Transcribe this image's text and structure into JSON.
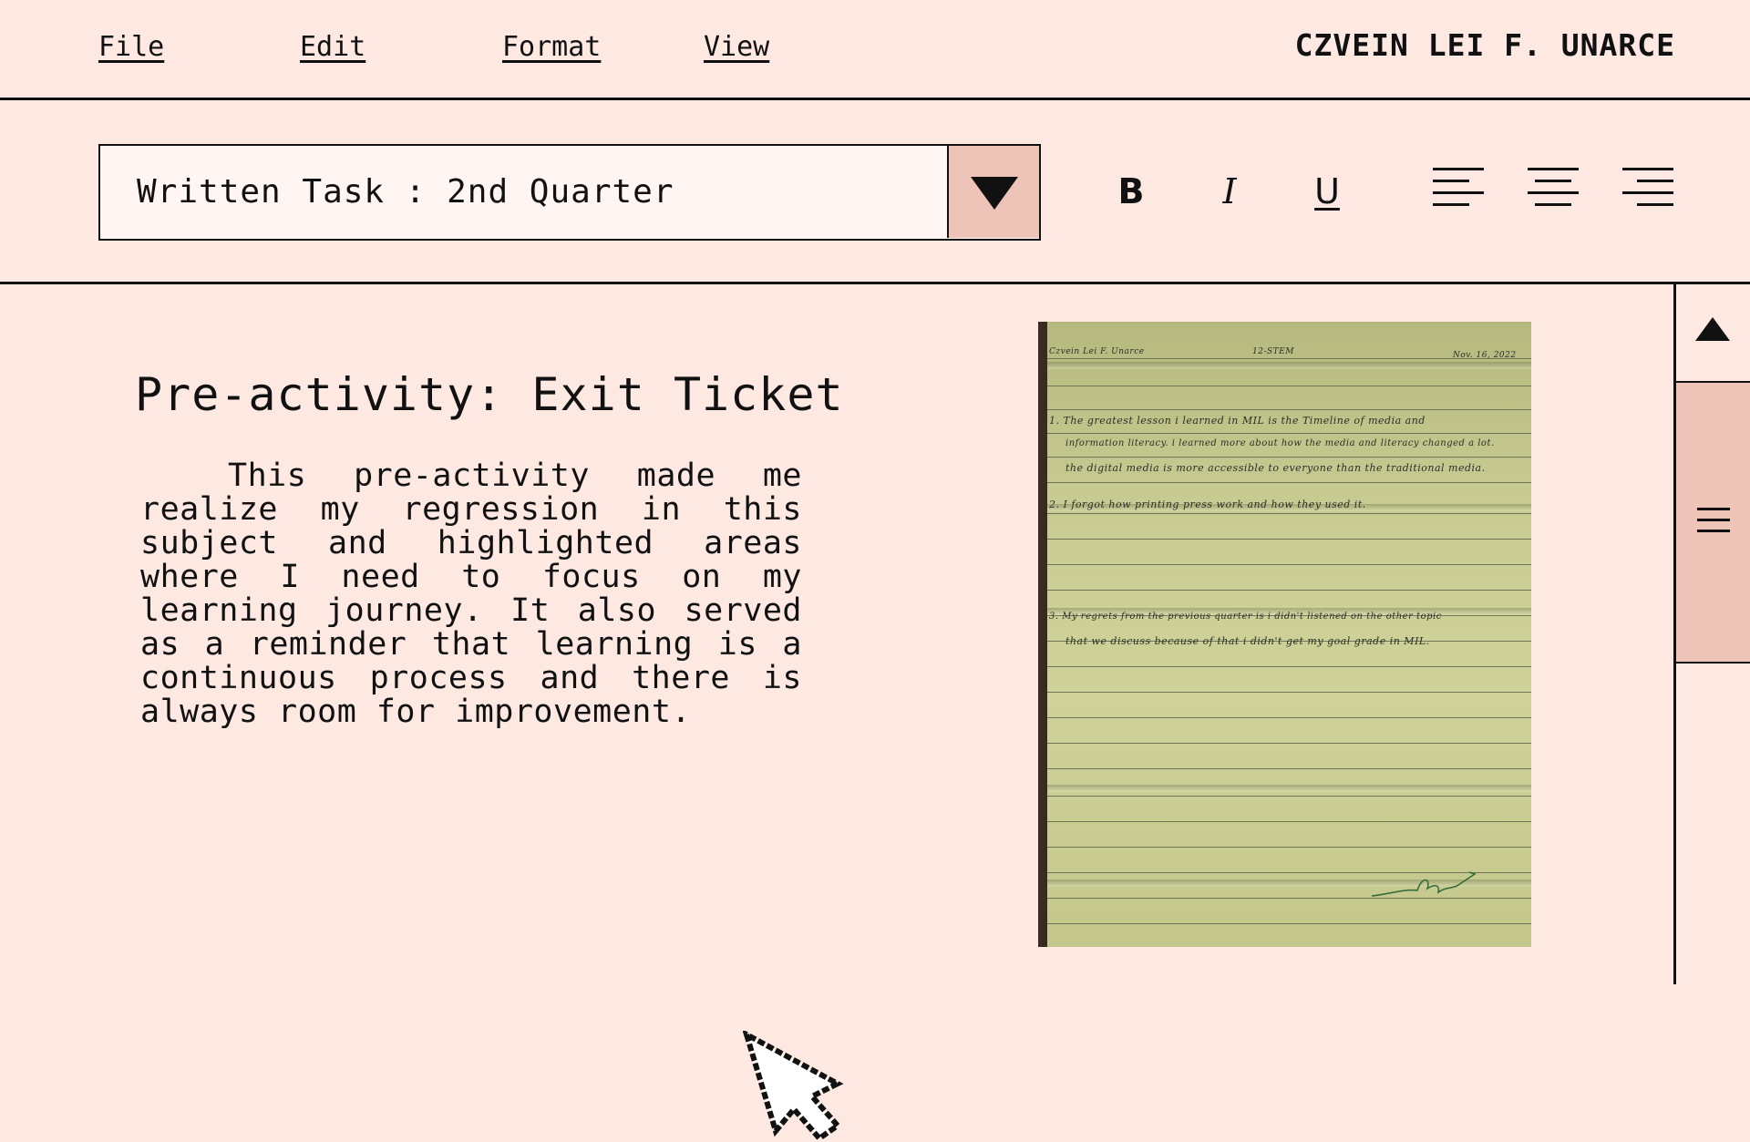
{
  "menu": {
    "file": "File",
    "edit": "Edit",
    "format": "Format",
    "view": "View"
  },
  "user": {
    "name": "CZVEIN LEI F. UNARCE"
  },
  "toolbar": {
    "document_select": "Written Task : 2nd Quarter",
    "bold_label": "B",
    "italic_label": "I",
    "underline_label": "U",
    "icons": [
      "dropdown-arrow-icon",
      "align-left-icon",
      "align-center-icon",
      "align-right-icon"
    ]
  },
  "document": {
    "title": "Pre-activity: Exit Ticket",
    "body": "This pre-activity made me realize my regression in this subject and highlighted areas where I need to focus on my learning journey. It also served as a reminder that learning is a continuous process and there is always room for improvement."
  },
  "photo": {
    "header_name": "Czvein Lei F. Unarce",
    "header_section": "12-STEM",
    "header_date": "Nov. 16, 2022",
    "lines": [
      "1. The greatest lesson i learned in MIL is the Timeline of media and",
      "information literacy. i learned more about how the media and literacy changed a lot.",
      "the digital media is more accessible to everyone than the traditional media.",
      "2. I forgot how printing press work and how they used it.",
      "3. My regrets from the previous quarter is i didn't listened on the other topic",
      "that we discuss because of that i didn't get my goal grade in MIL."
    ]
  },
  "scrollbar": {
    "icons": [
      "scroll-up-icon",
      "menu-grip-icon"
    ]
  },
  "colors": {
    "background": "#fee9e2",
    "accent": "#efc4b8",
    "ink": "#111111"
  }
}
